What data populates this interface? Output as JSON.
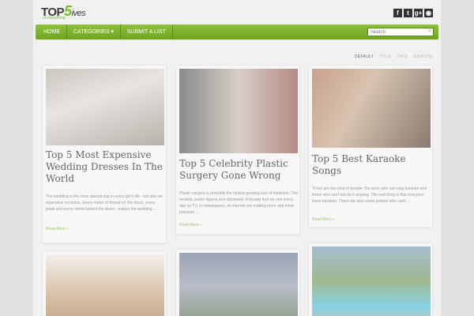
{
  "header": {
    "logo_main": "TOP",
    "logo_five": "5",
    "logo_ives": "ives",
    "logo_tagline": "of everything",
    "social": [
      "f",
      "t",
      "g+",
      "rss"
    ]
  },
  "nav": {
    "items": [
      "HOME",
      "CATEGORIES",
      "SUBMIT A LIST"
    ],
    "search_placeholder": "Search"
  },
  "sort": {
    "options": [
      "DEFAULT",
      "TITLE",
      "DATE",
      "RANDOM"
    ]
  },
  "cards": [
    {
      "title": "Top 5 Most Expensive Wedding Dresses In The World",
      "excerpt": "The wedding is the most special day in every girl's life - but also an expensive occasion. Every meter of thread on the dress, every jewel and every name behind the dress - makes the wedding ...",
      "more": "Read More »"
    },
    {
      "title": "Top 5 Celebrity Plastic Surgery Gone Wrong",
      "excerpt": "Plastic surgery is probably the fastest growing part of medicine. The models, public figures and standards of beauty that we see every day on TV, in newspapers, on internet are making more and more pressure ...",
      "more": "Read More »"
    },
    {
      "title": "Top 5 Best Karaoke Songs",
      "excerpt": "There are two kind of people- the ones who can sing karaoke and those who can't but do it anyway. The real thing is that everyone loves karaoke. There are also some junkies who can't ...",
      "more": "Read More »"
    }
  ],
  "colors": {
    "accent": "#7bbd2a",
    "nav_top": "#8fc23c",
    "nav_bottom": "#6da41f"
  }
}
